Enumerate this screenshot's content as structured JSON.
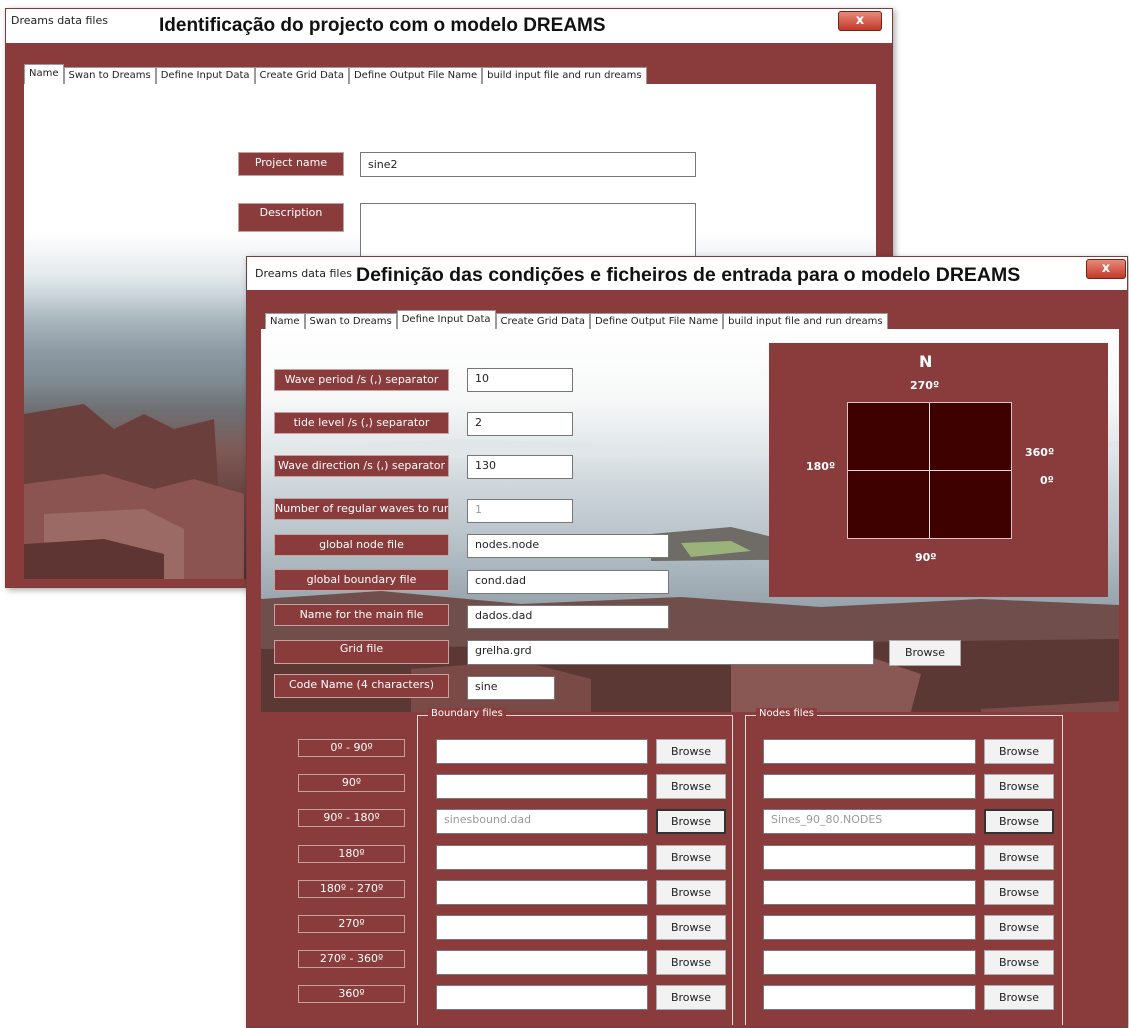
{
  "window1": {
    "app_name": "Dreams data files",
    "title": "Identificação do projecto com o modelo DREAMS",
    "close_label": "x",
    "tabs": [
      "Name",
      "Swan to Dreams",
      "Define Input Data",
      "Create Grid Data",
      "Define Output File Name",
      "build input file and run dreams"
    ],
    "active_tab": "Name",
    "project_name_label": "Project name",
    "project_name_value": "sine2",
    "description_label": "Description",
    "description_value": ""
  },
  "window2": {
    "app_name": "Dreams data files",
    "title": "Definição das condições e ficheiros de entrada para o modelo DREAMS",
    "close_label": "x",
    "tabs": [
      "Name",
      "Swan to Dreams",
      "Define Input Data",
      "Create Grid Data",
      "Define Output File Name",
      "build input file and run dreams"
    ],
    "active_tab": "Define Input Data",
    "fields": {
      "wave_period_label": "Wave period /s (,) separator",
      "wave_period_value": "10",
      "tide_level_label": "tide level /s (,) separator",
      "tide_level_value": "2",
      "wave_direction_label": "Wave direction /s (,) separator",
      "wave_direction_value": "130",
      "regular_waves_label": "Number of regular waves to run",
      "regular_waves_value": "1",
      "global_node_label": "global node file",
      "global_node_value": "nodes.node",
      "global_boundary_label": "global boundary file",
      "global_boundary_value": "cond.dad",
      "main_file_label": "Name for the main file",
      "main_file_value": "dados.dad",
      "grid_file_label": "Grid file",
      "grid_file_value": "grelha.grd",
      "grid_browse_label": "Browse",
      "code_name_label": "Code Name (4 characters)",
      "code_name_value": "sine"
    },
    "compass": {
      "north": "N",
      "top": "270º",
      "left": "180º",
      "right_upper": "360º",
      "right_lower": "0º",
      "bottom": "90º"
    },
    "boundary_group_label": "Boundary files",
    "nodes_group_label": "Nodes files",
    "browse_label": "Browse",
    "rows": [
      {
        "range": "0º - 90º",
        "boundary": "",
        "nodes": ""
      },
      {
        "range": "90º",
        "boundary": "",
        "nodes": ""
      },
      {
        "range": "90º - 180º",
        "boundary": "sinesbound.dad",
        "nodes": "Sines_90_80.NODES"
      },
      {
        "range": "180º",
        "boundary": "",
        "nodes": ""
      },
      {
        "range": "180º - 270º",
        "boundary": "",
        "nodes": ""
      },
      {
        "range": "270º",
        "boundary": "",
        "nodes": ""
      },
      {
        "range": "270º - 360º",
        "boundary": "",
        "nodes": ""
      },
      {
        "range": "360º",
        "boundary": "",
        "nodes": ""
      }
    ]
  }
}
